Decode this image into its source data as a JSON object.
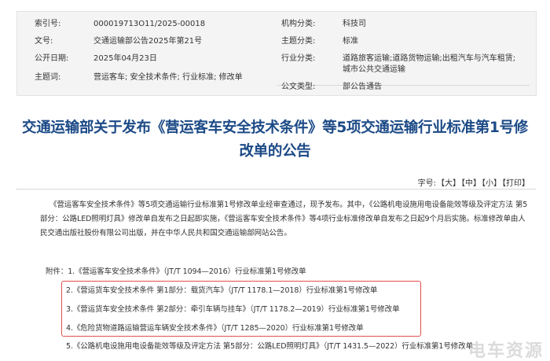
{
  "meta": {
    "rows": [
      {
        "label1": "索引号:",
        "value1": "000019713O11/2025-00018",
        "label2": "机构分类:",
        "value2": "科技司"
      },
      {
        "label1": "文号:",
        "value1": "交通运输部公告2025年第21号",
        "label2": "主题分类:",
        "value2": "标准"
      },
      {
        "label1": "公开日期:",
        "value1": "2025年04月23日",
        "label2": "行业分类:",
        "value2": "道路旅客运输;道路货物运输;出租汽车与汽车租赁;城市公共交通运输"
      },
      {
        "label1": "主题词:",
        "value1": "营运客车; 安全技术条件; 行业标准; 修改单",
        "label2": "",
        "value2": ""
      },
      {
        "label1": "",
        "value1": "",
        "label2": "公文类型:",
        "value2": "部公告通告"
      }
    ]
  },
  "title": "交通运输部关于发布《营运客车安全技术条件》等5项交通运输行业标准第1号修改单的公告",
  "font_size": {
    "label": "字号:",
    "large": "【大】",
    "medium": "【中】",
    "small": "【小】",
    "print": "【打印】"
  },
  "body": "《营运客车安全技术条件》等5项交通运输行业标准第1号修改单业经审查通过，现予发布。其中，《公路机电设施用电设备能效等级及评定方法 第5部分：公路LED照明灯具》修改单自发布之日起即实施，《营运客车安全技术条件》等4项行业标准修改单自发布之日起9个月后实施。标准修改单由人民交通出版社股份有限公司出版，并在中华人民共和国交通运输部网站公告。",
  "attachments": {
    "prefix": "附件：",
    "items": [
      "1.《营运客车安全技术条件》（JT/T 1094—2016）行业标准第1号修改单",
      "2.《营运货车安全技术条件 第1部分：载货汽车》（JT/T 1178.1—2018）行业标准第1号修改单",
      "3.《营运货车安全技术条件 第2部分：牵引车辆与挂车》（JT/T 1178.2—2019）行业标准第1号修改单",
      "4.《危险货物道路运输营运车辆安全技术条件》（JT/T 1285—2020）行业标准第1号修改单",
      "5.《公路机电设施用电设备能效等级及评定方法 第5部分：公路LED照明灯具》（JT/T 1431.5—2022）行业标准第1号修改单"
    ]
  },
  "watermark": "电车资源",
  "colors": {
    "title": "#1c4a86",
    "highlight": "#e0504d",
    "meta_bg": "#f4f4f4"
  }
}
